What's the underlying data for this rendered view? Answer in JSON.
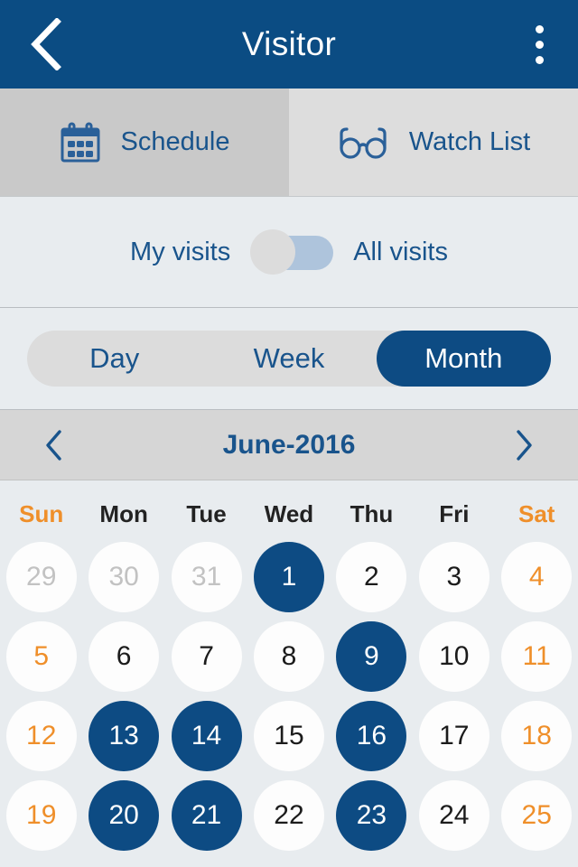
{
  "header": {
    "title": "Visitor",
    "back_icon": "chevron-left-icon",
    "overflow_icon": "more-vertical-icon"
  },
  "tabs": [
    {
      "label": "Schedule",
      "icon": "calendar-icon",
      "active": true
    },
    {
      "label": "Watch List",
      "icon": "glasses-icon",
      "active": false
    }
  ],
  "visits_filter": {
    "left_label": "My visits",
    "right_label": "All visits",
    "selected": "My visits",
    "knob_position": "left"
  },
  "view_selector": {
    "options": [
      "Day",
      "Week",
      "Month"
    ],
    "selected": "Month"
  },
  "month_nav": {
    "prev_icon": "chevron-left-icon",
    "next_icon": "chevron-right-icon",
    "title": "June-2016"
  },
  "calendar": {
    "weekdays": [
      {
        "label": "Sun",
        "weekend": true
      },
      {
        "label": "Mon",
        "weekend": false
      },
      {
        "label": "Tue",
        "weekend": false
      },
      {
        "label": "Wed",
        "weekend": false
      },
      {
        "label": "Thu",
        "weekend": false
      },
      {
        "label": "Fri",
        "weekend": false
      },
      {
        "label": "Sat",
        "weekend": true
      }
    ],
    "weeks": [
      [
        {
          "day": "29",
          "muted": true,
          "weekend": true,
          "selected": false
        },
        {
          "day": "30",
          "muted": true,
          "weekend": false,
          "selected": false
        },
        {
          "day": "31",
          "muted": true,
          "weekend": false,
          "selected": false
        },
        {
          "day": "1",
          "muted": false,
          "weekend": false,
          "selected": true
        },
        {
          "day": "2",
          "muted": false,
          "weekend": false,
          "selected": false
        },
        {
          "day": "3",
          "muted": false,
          "weekend": false,
          "selected": false
        },
        {
          "day": "4",
          "muted": false,
          "weekend": true,
          "selected": false
        }
      ],
      [
        {
          "day": "5",
          "muted": false,
          "weekend": true,
          "selected": false
        },
        {
          "day": "6",
          "muted": false,
          "weekend": false,
          "selected": false
        },
        {
          "day": "7",
          "muted": false,
          "weekend": false,
          "selected": false
        },
        {
          "day": "8",
          "muted": false,
          "weekend": false,
          "selected": false
        },
        {
          "day": "9",
          "muted": false,
          "weekend": false,
          "selected": true
        },
        {
          "day": "10",
          "muted": false,
          "weekend": false,
          "selected": false
        },
        {
          "day": "11",
          "muted": false,
          "weekend": true,
          "selected": false
        }
      ],
      [
        {
          "day": "12",
          "muted": false,
          "weekend": true,
          "selected": false
        },
        {
          "day": "13",
          "muted": false,
          "weekend": false,
          "selected": true
        },
        {
          "day": "14",
          "muted": false,
          "weekend": false,
          "selected": true
        },
        {
          "day": "15",
          "muted": false,
          "weekend": false,
          "selected": false
        },
        {
          "day": "16",
          "muted": false,
          "weekend": false,
          "selected": true
        },
        {
          "day": "17",
          "muted": false,
          "weekend": false,
          "selected": false
        },
        {
          "day": "18",
          "muted": false,
          "weekend": true,
          "selected": false
        }
      ],
      [
        {
          "day": "19",
          "muted": false,
          "weekend": true,
          "selected": false
        },
        {
          "day": "20",
          "muted": false,
          "weekend": false,
          "selected": true
        },
        {
          "day": "21",
          "muted": false,
          "weekend": false,
          "selected": true
        },
        {
          "day": "22",
          "muted": false,
          "weekend": false,
          "selected": false
        },
        {
          "day": "23",
          "muted": false,
          "weekend": false,
          "selected": true
        },
        {
          "day": "24",
          "muted": false,
          "weekend": false,
          "selected": false
        },
        {
          "day": "25",
          "muted": false,
          "weekend": true,
          "selected": false
        }
      ]
    ]
  },
  "colors": {
    "brand_blue": "#0b4c83",
    "selected_day": "#0d4b83",
    "weekend_orange": "#ef8f2a",
    "page_bg": "#e8ecef",
    "tab_active_bg": "#c9c9c9",
    "tab_inactive_bg": "#dddddd",
    "month_nav_bg": "#d6d6d6"
  }
}
